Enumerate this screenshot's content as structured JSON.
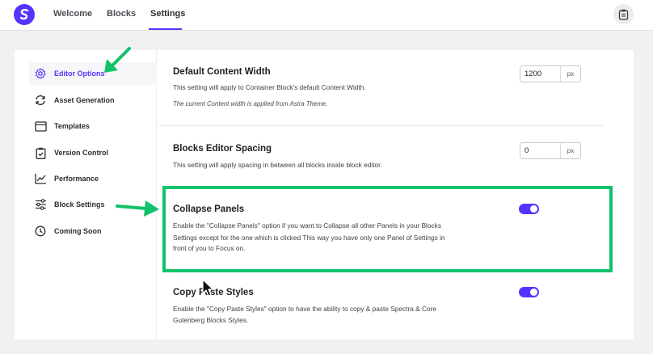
{
  "header": {
    "tabs": [
      {
        "label": "Welcome"
      },
      {
        "label": "Blocks"
      },
      {
        "label": "Settings"
      }
    ],
    "active_tab": "Settings",
    "brand_color": "#5733ff",
    "logo_icon": "spectra-logo-icon",
    "doc_icon": "clipboard-icon"
  },
  "sidebar": {
    "items": [
      {
        "label": "Editor Options",
        "icon": "gear-icon",
        "active": true
      },
      {
        "label": "Asset Generation",
        "icon": "refresh-icon"
      },
      {
        "label": "Templates",
        "icon": "window-icon"
      },
      {
        "label": "Version Control",
        "icon": "clipboard-check-icon"
      },
      {
        "label": "Performance",
        "icon": "chart-line-icon"
      },
      {
        "label": "Block Settings",
        "icon": "sliders-icon"
      },
      {
        "label": "Coming Soon",
        "icon": "clock-icon"
      }
    ]
  },
  "settings": {
    "content_width": {
      "title": "Default Content Width",
      "desc": "This setting will apply to Container Block's default Content Width.",
      "note": "The current Content width is applied from Astra Theme.",
      "value": "1200",
      "unit": "px"
    },
    "spacing": {
      "title": "Blocks Editor Spacing",
      "desc": "This setting will apply spacing in between all blocks inside block editor.",
      "value": "0",
      "unit": "px"
    },
    "collapse": {
      "title": "Collapse Panels",
      "desc_lines": [
        "Enable the \"Collapse Panels\" option if you want to Collapse all other Panels in your Blocks",
        "Settings except for the one which is clicked This way you have only one Panel of Settings in",
        "front of you to Focus on."
      ],
      "enabled": true
    },
    "copy_paste": {
      "title": "Copy Paste Styles",
      "desc_lines": [
        "Enable the \"Copy Paste Styles\" option to have the ability to copy & paste Spectra & Core",
        "Gutenberg Blocks Styles."
      ],
      "enabled": true
    }
  },
  "annotations": {
    "highlight_color": "#12c26a"
  }
}
